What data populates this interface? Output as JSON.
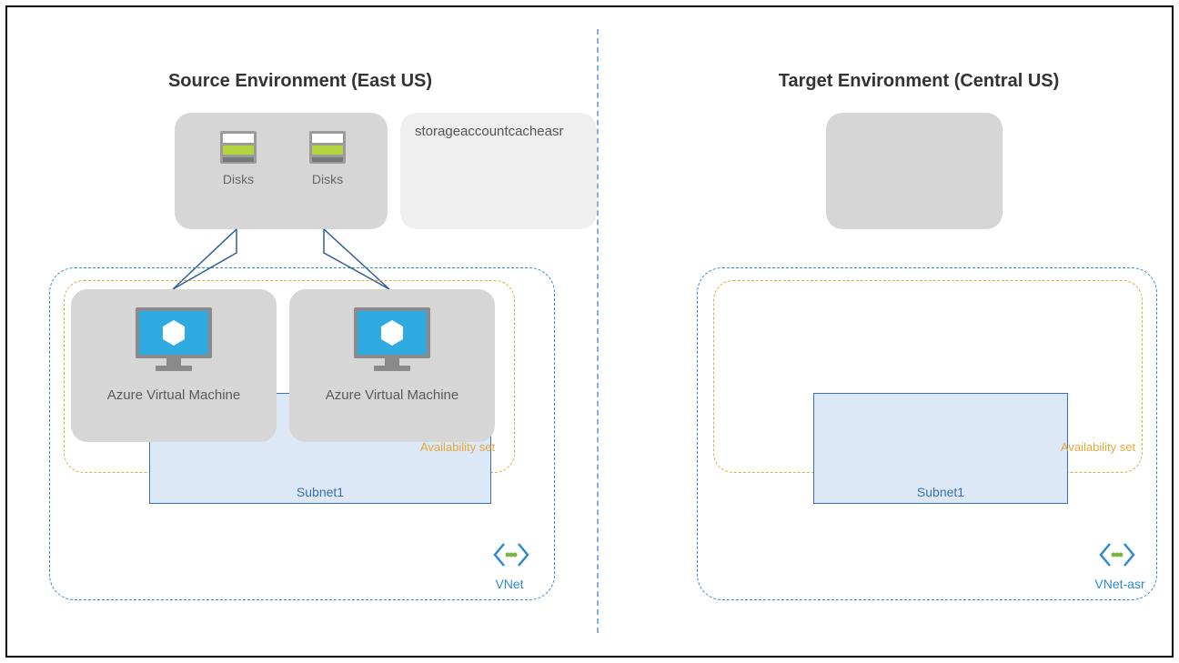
{
  "source": {
    "title": "Source Environment (East US)",
    "disks": [
      "Disks",
      "Disks"
    ],
    "storage_label": "storageaccountcacheasr",
    "vms": [
      "Azure Virtual Machine",
      "Azure Virtual Machine"
    ],
    "availability_set_label": "Availability set",
    "subnet_label": "Subnet1",
    "vnet_label": "VNet"
  },
  "target": {
    "title": "Target Environment (Central US)",
    "availability_set_label": "Availability set",
    "subnet_label": "Subnet1",
    "vnet_label": "VNet-asr"
  }
}
